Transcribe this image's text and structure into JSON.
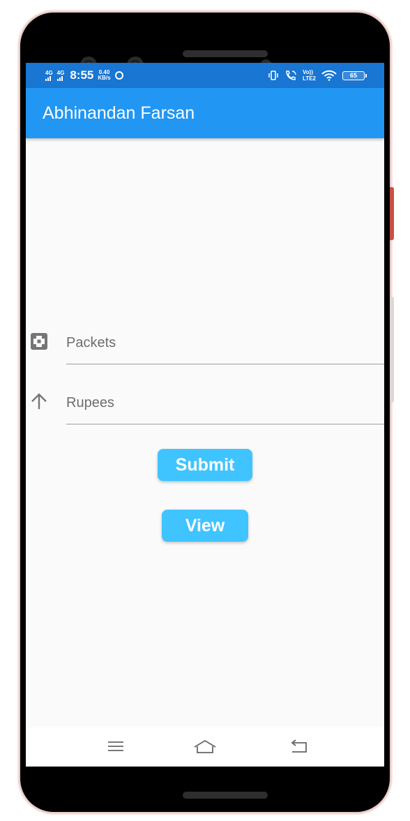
{
  "status_bar": {
    "network1": "4G",
    "network2": "4G",
    "time": "8:55",
    "speed_value": "0.40",
    "speed_unit": "KB/s",
    "volte_top": "Vo))",
    "volte_bottom": "LTE2",
    "battery": "65",
    "icons": [
      "signal-icon",
      "whatsapp-icon",
      "vibrate-icon",
      "call-icon",
      "wifi-icon",
      "battery-icon"
    ]
  },
  "app_bar": {
    "title": "Abhinandan Farsan",
    "color": "#2196f3"
  },
  "form": {
    "packets": {
      "placeholder": "Packets",
      "icon": "box-icon"
    },
    "rupees": {
      "placeholder": "Rupees",
      "icon": "arrow-up-icon"
    }
  },
  "buttons": {
    "submit_label": "Submit",
    "view_label": "View",
    "color": "#40c4ff"
  },
  "nav_bar": {
    "icons": [
      "menu-icon",
      "home-icon",
      "back-icon"
    ]
  }
}
